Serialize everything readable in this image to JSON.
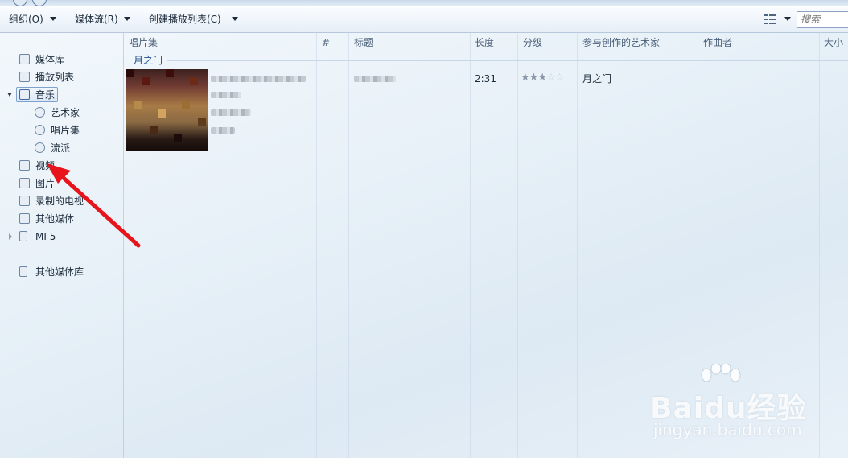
{
  "toolbar": {
    "organize_label": "组织(O)",
    "stream_label": "媒体流(R)",
    "create_playlist_label": "创建播放列表(C)",
    "search_placeholder": "搜索"
  },
  "sidebar": {
    "items": [
      {
        "label": "媒体库",
        "icon": "library-icon"
      },
      {
        "label": "播放列表",
        "icon": "playlist-icon"
      },
      {
        "label": "音乐",
        "icon": "music-note-icon",
        "selected": true
      },
      {
        "label": "艺术家",
        "icon": "artist-icon"
      },
      {
        "label": "唱片集",
        "icon": "album-icon"
      },
      {
        "label": "流派",
        "icon": "genre-icon"
      },
      {
        "label": "视频",
        "icon": "video-icon"
      },
      {
        "label": "图片",
        "icon": "picture-icon"
      },
      {
        "label": "录制的电视",
        "icon": "tv-icon"
      },
      {
        "label": "其他媒体",
        "icon": "other-media-icon"
      },
      {
        "label": "MI 5",
        "icon": "phone-icon"
      },
      {
        "label": "其他媒体库",
        "icon": "other-library-icon"
      }
    ]
  },
  "columns": [
    "唱片集",
    "#",
    "标题",
    "长度",
    "分级",
    "参与创作的艺术家",
    "作曲者",
    "大小"
  ],
  "group": {
    "label": "月之门"
  },
  "track": {
    "length": "2:31",
    "rating": 3,
    "rating_max": 5,
    "contributing_artist": "月之门"
  },
  "watermark": {
    "brand": "Baidu经验",
    "url": "jingyan.baidu.com"
  },
  "colors": {
    "accent": "#1f4f8f",
    "annotation_arrow": "#e8141b"
  }
}
